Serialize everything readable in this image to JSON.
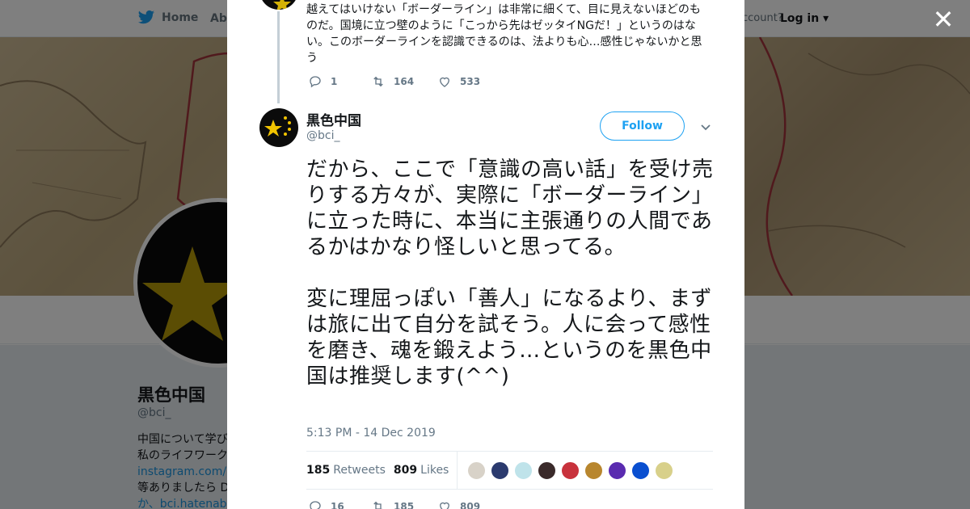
{
  "nav": {
    "home_label": "Home",
    "about_label": "Abo",
    "account_text": "ccount?",
    "login_label": "Log in"
  },
  "profile": {
    "name": "黒色中国",
    "handle": "@bci_",
    "bio_lines": [
      "中国について学び",
      "私のライフワーク",
      "instagram.com/bla",
      "等ありましたら D",
      "か、bci.hatenablo"
    ]
  },
  "previous_tweet": {
    "text": "越えてはいけない「ボーダーライン」は非常に細くて、目に見えないほどのものだ。国境に立つ壁のように「こっから先はゼッタイNGだ！」というのはない。このボーダーラインを認識できるのは、法よりも心…感性じゃないかと思う",
    "replies": "1",
    "retweets": "164",
    "likes": "533"
  },
  "tweet": {
    "author_name": "黒色中国",
    "author_handle": "@bci_",
    "follow_label": "Follow",
    "paragraph1": "だから、ここで「意識の高い話」を受け売りする方々が、実際に「ボーダーライン」に立った時に、本当に主張通りの人間であるかはかなり怪しいと思ってる。",
    "paragraph2": "変に理屈っぽい「善人」になるより、まずは旅に出て自分を試そう。人に会って感性を磨き、魂を鍛えよう…というのを黒色中国は推奨します(^^)",
    "timestamp": "5:13 PM - 14 Dec 2019",
    "retweet_count": "185",
    "retweet_label": "Retweets",
    "like_count": "809",
    "like_label": "Likes",
    "replies": "16",
    "retweets": "185",
    "likes": "809"
  },
  "liker_colors": [
    "#d8d2c8",
    "#2b3a6e",
    "#bfe3ea",
    "#3a2a2a",
    "#c8323c",
    "#b8862e",
    "#5a2bb0",
    "#0a4fd0",
    "#d8d08a"
  ],
  "colors": {
    "accent": "#1da1f2",
    "star": "#d4b106",
    "overlay": "rgba(0,0,0,0.5)"
  }
}
